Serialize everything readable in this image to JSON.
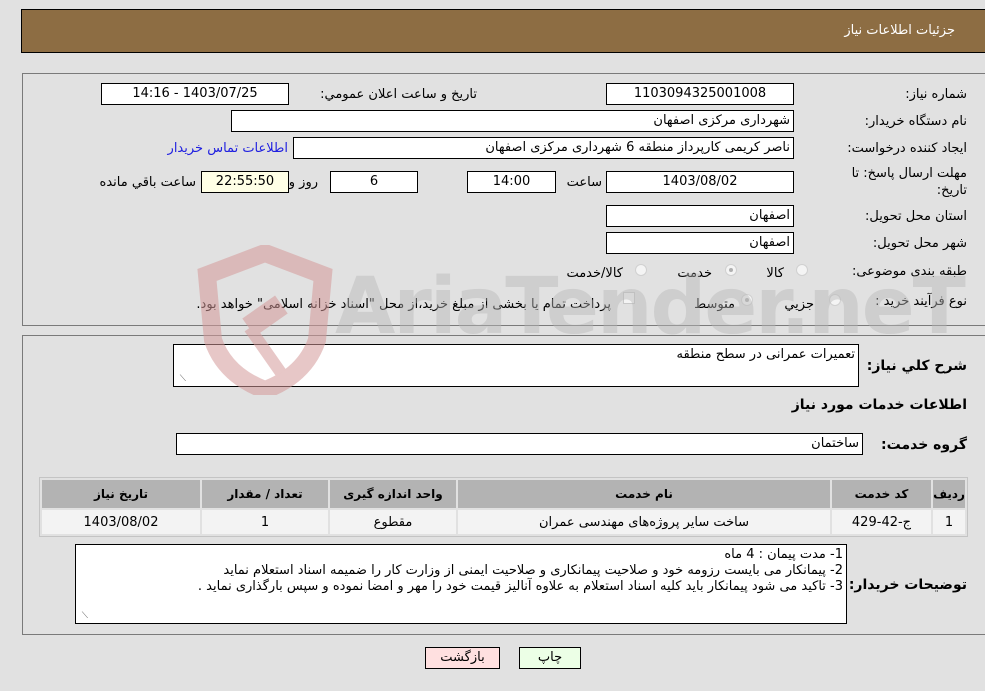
{
  "header": {
    "title": "جزئیات اطلاعات نیاز"
  },
  "info": {
    "need_number_label": "شماره نیاز:",
    "need_number": "1103094325001008",
    "announce_label": "تاریخ و ساعت اعلان عمومي:",
    "announce_value": "1403/07/25 - 14:16",
    "buyer_org_label": "نام دستگاه خریدار:",
    "buyer_org": "شهرداری مرکزی اصفهان",
    "creator_label": "ایجاد کننده درخواست:",
    "creator": "ناصر کریمی کارپرداز منطقه 6 شهرداری مرکزی اصفهان",
    "contact_link": "اطلاعات تماس خریدار",
    "deadline_label_line1": "مهلت ارسال پاسخ: تا",
    "deadline_label_line2": "تاریخ:",
    "deadline_date": "1403/08/02",
    "hour_label": "ساعت",
    "deadline_time": "14:00",
    "days": "6",
    "days_label": "روز و",
    "remaining_time": "22:55:50",
    "remaining_label": "ساعت باقي مانده",
    "province_label": "استان محل تحویل:",
    "province": "اصفهان",
    "city_label": "شهر محل تحویل:",
    "city": "اصفهان",
    "category_label": "طبقه بندی موضوعی:",
    "category_options": [
      {
        "label": "کالا",
        "checked": false
      },
      {
        "label": "خدمت",
        "checked": true
      },
      {
        "label": "کالا/خدمت",
        "checked": false
      }
    ],
    "purchase_type_label": "نوع فرآیند خرید :",
    "purchase_type_options": [
      {
        "label": "جزيي",
        "checked": false
      },
      {
        "label": "متوسط",
        "checked": true
      }
    ],
    "treasury_note": "پرداخت تمام یا بخشی از مبلغ خرید،از محل \"اسناد خزانه اسلامی\" خواهد بود.",
    "treasury_checked": false
  },
  "details": {
    "general_desc_label": "شرح کلي نیاز:",
    "general_desc": "تعمیرات عمرانی در سطح منطقه",
    "services_heading": "اطلاعات خدمات مورد نیاز",
    "service_group_label": "گروه خدمت:",
    "service_group": "ساختمان",
    "table": {
      "headers": [
        "ردیف",
        "کد خدمت",
        "نام خدمت",
        "واحد اندازه گیری",
        "تعداد / مقدار",
        "تاریخ نیاز"
      ],
      "rows": [
        [
          "1",
          "ج-42-429",
          "ساخت سایر پروژه‌های مهندسی عمران",
          "مقطوع",
          "1",
          "1403/08/02"
        ]
      ]
    },
    "buyer_notes_label": "توضیحات خریدار:",
    "buyer_notes": [
      "1- مدت پیمان : 4 ماه",
      "2- پیمانکار می بایست رزومه خود و صلاحیت پیمانکاری و صلاحیت ایمنی از وزارت کار را ضمیمه اسناد استعلام نماید",
      "3- تاکید می شود پیمانکار باید کلیه اسناد استعلام به علاوه آنالیز قیمت خود را مهر و امضا نموده و سپس بارگذاری نماید ."
    ]
  },
  "buttons": {
    "print": "چاپ",
    "back": "بازگشت"
  },
  "watermark": {
    "text": "AriaTender.neT"
  }
}
